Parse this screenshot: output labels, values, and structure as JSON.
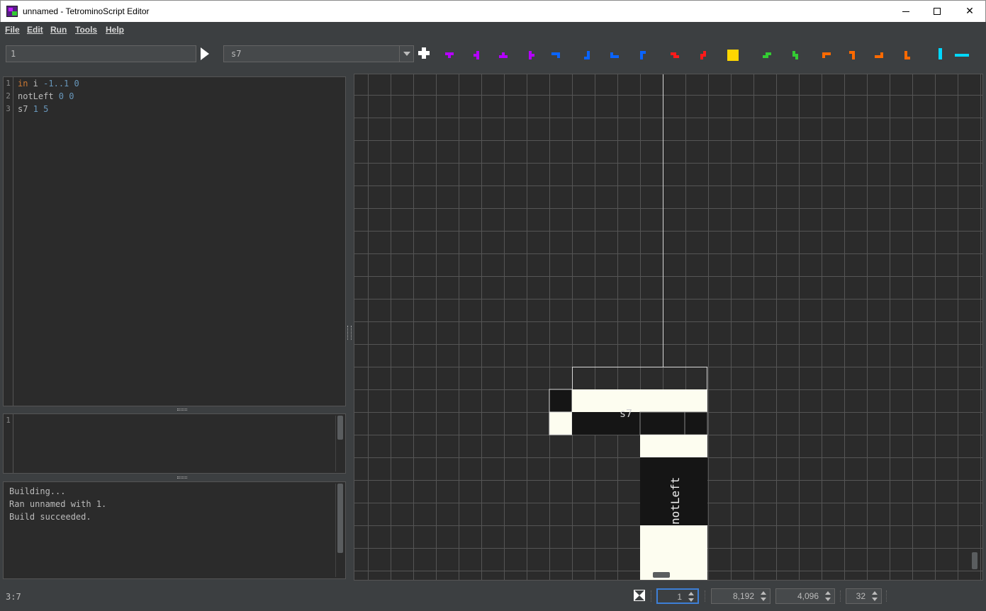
{
  "window": {
    "title": "unnamed - TetrominoScript Editor"
  },
  "menu": {
    "file": "File",
    "edit": "Edit",
    "run": "Run",
    "tools": "Tools",
    "help": "Help"
  },
  "toolbar": {
    "param_value": "1",
    "piece_selected": "s7",
    "pieces": [
      {
        "name": "t-piece-down-icon",
        "color": "#b400ff"
      },
      {
        "name": "t-piece-left-icon",
        "color": "#b400ff"
      },
      {
        "name": "t-piece-up-icon",
        "color": "#b400ff"
      },
      {
        "name": "t-piece-right-icon",
        "color": "#b400ff"
      },
      {
        "name": "j-piece-1-icon",
        "color": "#0a64ff"
      },
      {
        "name": "j-piece-2-icon",
        "color": "#0a64ff"
      },
      {
        "name": "j-piece-3-icon",
        "color": "#0a64ff"
      },
      {
        "name": "j-piece-4-icon",
        "color": "#0a64ff"
      },
      {
        "name": "z-piece-h-icon",
        "color": "#ff1a1a"
      },
      {
        "name": "z-piece-v-icon",
        "color": "#ff1a1a"
      },
      {
        "name": "o-piece-icon",
        "color": "#ffd700"
      },
      {
        "name": "s-piece-h-icon",
        "color": "#33cc33"
      },
      {
        "name": "s-piece-v-icon",
        "color": "#33cc33"
      },
      {
        "name": "l-piece-1-icon",
        "color": "#ff6a00"
      },
      {
        "name": "l-piece-2-icon",
        "color": "#ff6a00"
      },
      {
        "name": "l-piece-3-icon",
        "color": "#ff6a00"
      },
      {
        "name": "l-piece-4-icon",
        "color": "#ff6a00"
      },
      {
        "name": "i-piece-v-icon",
        "color": "#00d8ff"
      },
      {
        "name": "i-piece-h-icon",
        "color": "#00d8ff"
      }
    ]
  },
  "editor": {
    "line_numbers": [
      "1",
      "2",
      "3"
    ],
    "lines": [
      [
        {
          "t": "in",
          "c": "kw"
        },
        {
          "t": " i ",
          "c": ""
        },
        {
          "t": "-1..1 0",
          "c": "num"
        }
      ],
      [
        {
          "t": "notLeft ",
          "c": ""
        },
        {
          "t": "0 0",
          "c": "num"
        }
      ],
      [
        {
          "t": "s7 ",
          "c": ""
        },
        {
          "t": "1 5",
          "c": "num"
        }
      ]
    ]
  },
  "debug": {
    "line_number": "1"
  },
  "output": {
    "lines": [
      "Building...",
      "Ran unnamed with 1.",
      "Build succeeded."
    ]
  },
  "canvas": {
    "label_s7": "s7",
    "label_notleft": "notLeft",
    "colors": {
      "background": "#2b2b2b",
      "grid": "#555555",
      "light": "#fdfdf0",
      "dark": "#151515"
    }
  },
  "status": {
    "cursor": "3:7",
    "frame": "1",
    "width": "8,192",
    "height": "4,096",
    "cell_size": "32"
  }
}
